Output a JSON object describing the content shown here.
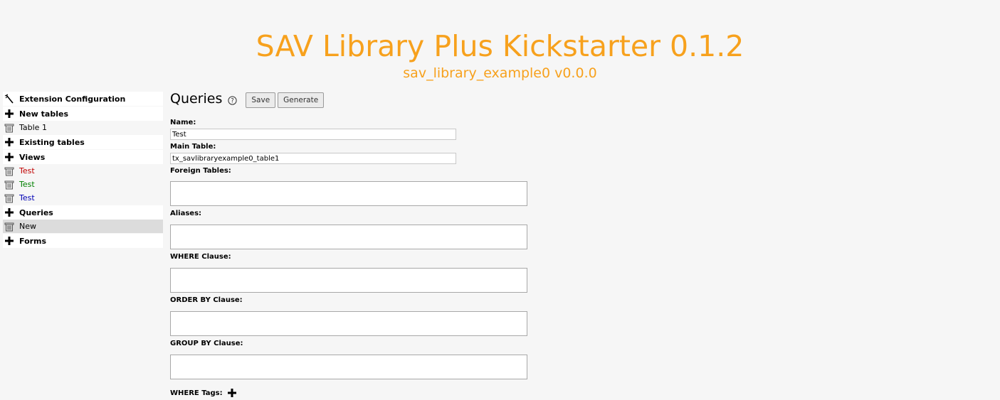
{
  "header": {
    "title": "SAV Library Plus Kickstarter 0.1.2",
    "subtitle": "sav_library_example0 v0.0.0"
  },
  "sidebar": {
    "items": [
      {
        "label": "Extension Configuration",
        "icon": "wand-icon"
      },
      {
        "label": "New tables",
        "icon": "plus-icon"
      },
      {
        "label": "Table 1",
        "icon": "trash-icon"
      },
      {
        "label": "Existing tables",
        "icon": "plus-icon"
      },
      {
        "label": "Views",
        "icon": "plus-icon"
      },
      {
        "label": "Test",
        "icon": "trash-icon",
        "color": "#c00000"
      },
      {
        "label": "Test",
        "icon": "trash-icon",
        "color": "#008000"
      },
      {
        "label": "Test",
        "icon": "trash-icon",
        "color": "#0000b4"
      },
      {
        "label": "Queries",
        "icon": "plus-icon"
      },
      {
        "label": "New",
        "icon": "trash-icon"
      },
      {
        "label": "Forms",
        "icon": "plus-icon"
      }
    ]
  },
  "main": {
    "title": "Queries",
    "help_icon": "help-icon",
    "save_label": "Save",
    "generate_label": "Generate",
    "fields": {
      "name_label": "Name:",
      "name_value": "Test",
      "main_table_label": "Main Table:",
      "main_table_value": "tx_savlibraryexample0_table1",
      "foreign_tables_label": "Foreign Tables:",
      "aliases_label": "Aliases:",
      "where_label": "WHERE Clause:",
      "order_by_label": "ORDER BY Clause:",
      "group_by_label": "GROUP BY Clause:",
      "where_tags_label": "WHERE Tags:"
    }
  },
  "colors": {
    "accent": "#f7a11d",
    "background": "#f6f6f6"
  }
}
